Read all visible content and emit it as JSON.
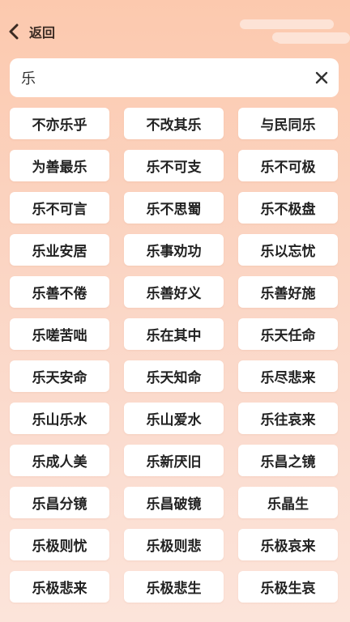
{
  "header": {
    "back_label": "返回",
    "back_icon": "chevron-left-icon"
  },
  "search": {
    "value": "乐",
    "clear_icon": "close-icon"
  },
  "idioms": [
    "不亦乐乎",
    "不改其乐",
    "与民同乐",
    "为善最乐",
    "乐不可支",
    "乐不可极",
    "乐不可言",
    "乐不思蜀",
    "乐不极盘",
    "乐业安居",
    "乐事劝功",
    "乐以忘忧",
    "乐善不倦",
    "乐善好义",
    "乐善好施",
    "乐嗟苦咄",
    "乐在其中",
    "乐天任命",
    "乐天安命",
    "乐天知命",
    "乐尽悲来",
    "乐山乐水",
    "乐山爱水",
    "乐往哀来",
    "乐成人美",
    "乐新厌旧",
    "乐昌之镜",
    "乐昌分镜",
    "乐昌破镜",
    "乐晶生",
    "乐极则忧",
    "乐极则悲",
    "乐极哀来",
    "乐极悲来",
    "乐极悲生",
    "乐极生哀"
  ],
  "colors": {
    "bg_top": "#fcc9ae",
    "bg_bottom": "#fce4da",
    "card": "#ffffff",
    "text": "#222222",
    "cursor": "#2e6ddc"
  }
}
